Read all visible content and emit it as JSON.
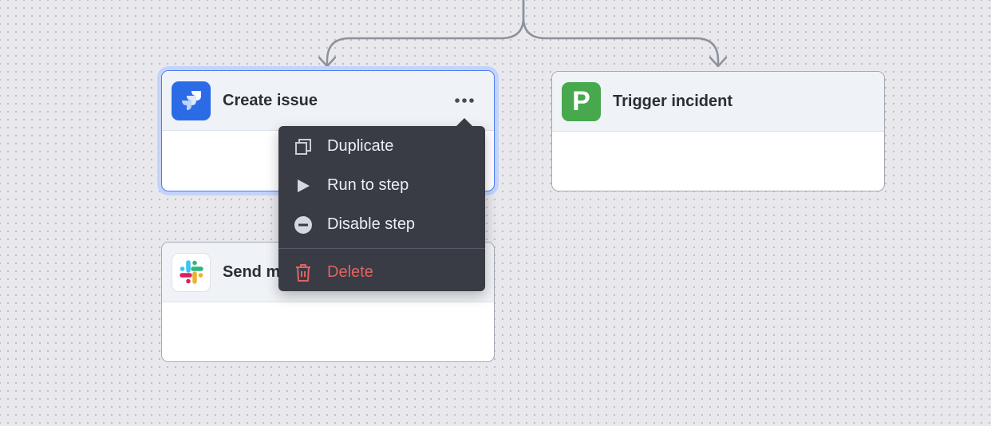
{
  "cards": {
    "create_issue": {
      "title": "Create issue",
      "app_icon": "jira-icon"
    },
    "trigger_incident": {
      "title": "Trigger incident",
      "app_icon": "pagerduty-icon",
      "icon_glyph": "P"
    },
    "send_message": {
      "title": "Send message",
      "app_icon": "slack-icon"
    }
  },
  "context_menu": {
    "items": [
      {
        "label": "Duplicate",
        "icon": "duplicate-icon"
      },
      {
        "label": "Run to step",
        "icon": "play-icon"
      },
      {
        "label": "Disable step",
        "icon": "disable-icon"
      },
      {
        "label": "Delete",
        "icon": "trash-icon"
      }
    ]
  },
  "colors": {
    "selection": "#4d7ef5",
    "jira": "#2b6ce6",
    "pagerduty": "#47a84d",
    "menu_bg": "#393b45",
    "danger": "#e06461"
  }
}
